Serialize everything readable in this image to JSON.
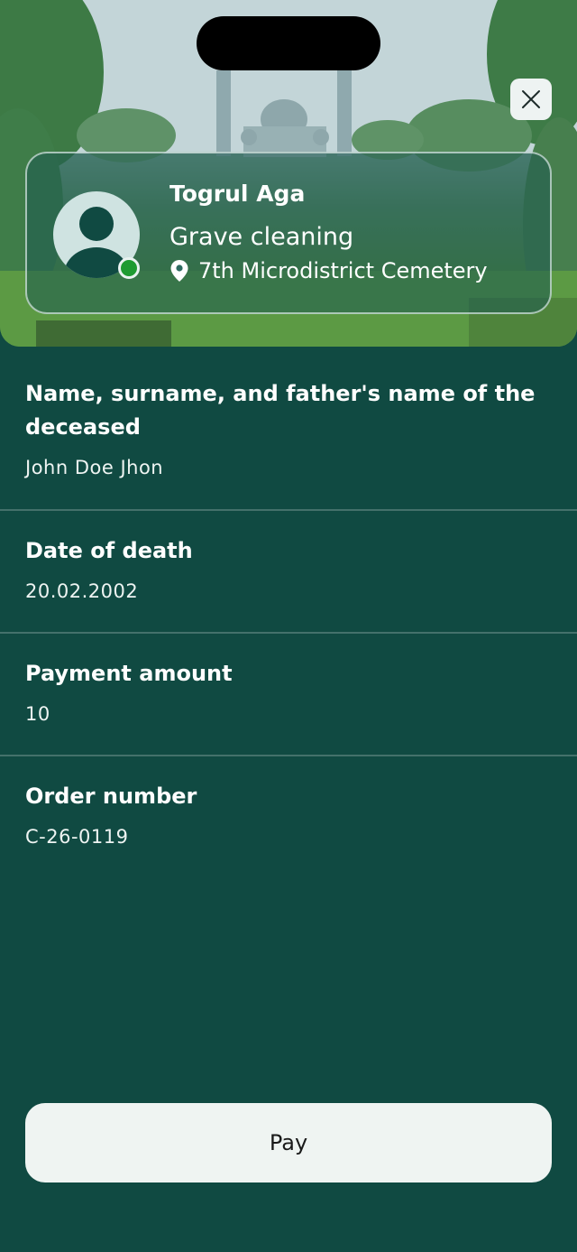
{
  "profile": {
    "name": "Togrul Aga",
    "service": "Grave cleaning",
    "location": "7th Microdistrict Cemetery",
    "status_color": "#1f9b32"
  },
  "details": [
    {
      "label": "Name, surname, and father's name of the deceased",
      "value": "John Doe Jhon"
    },
    {
      "label": "Date of death",
      "value": "20.02.2002"
    },
    {
      "label": "Payment amount",
      "value": "10"
    },
    {
      "label": "Order number",
      "value": "C-26-0119"
    }
  ],
  "actions": {
    "pay_label": "Pay"
  },
  "icons": {
    "close": "close-icon",
    "location": "location-pin-icon",
    "avatar": "user-avatar-icon"
  },
  "colors": {
    "background": "#104a42",
    "button_bg": "#eff4f2"
  }
}
